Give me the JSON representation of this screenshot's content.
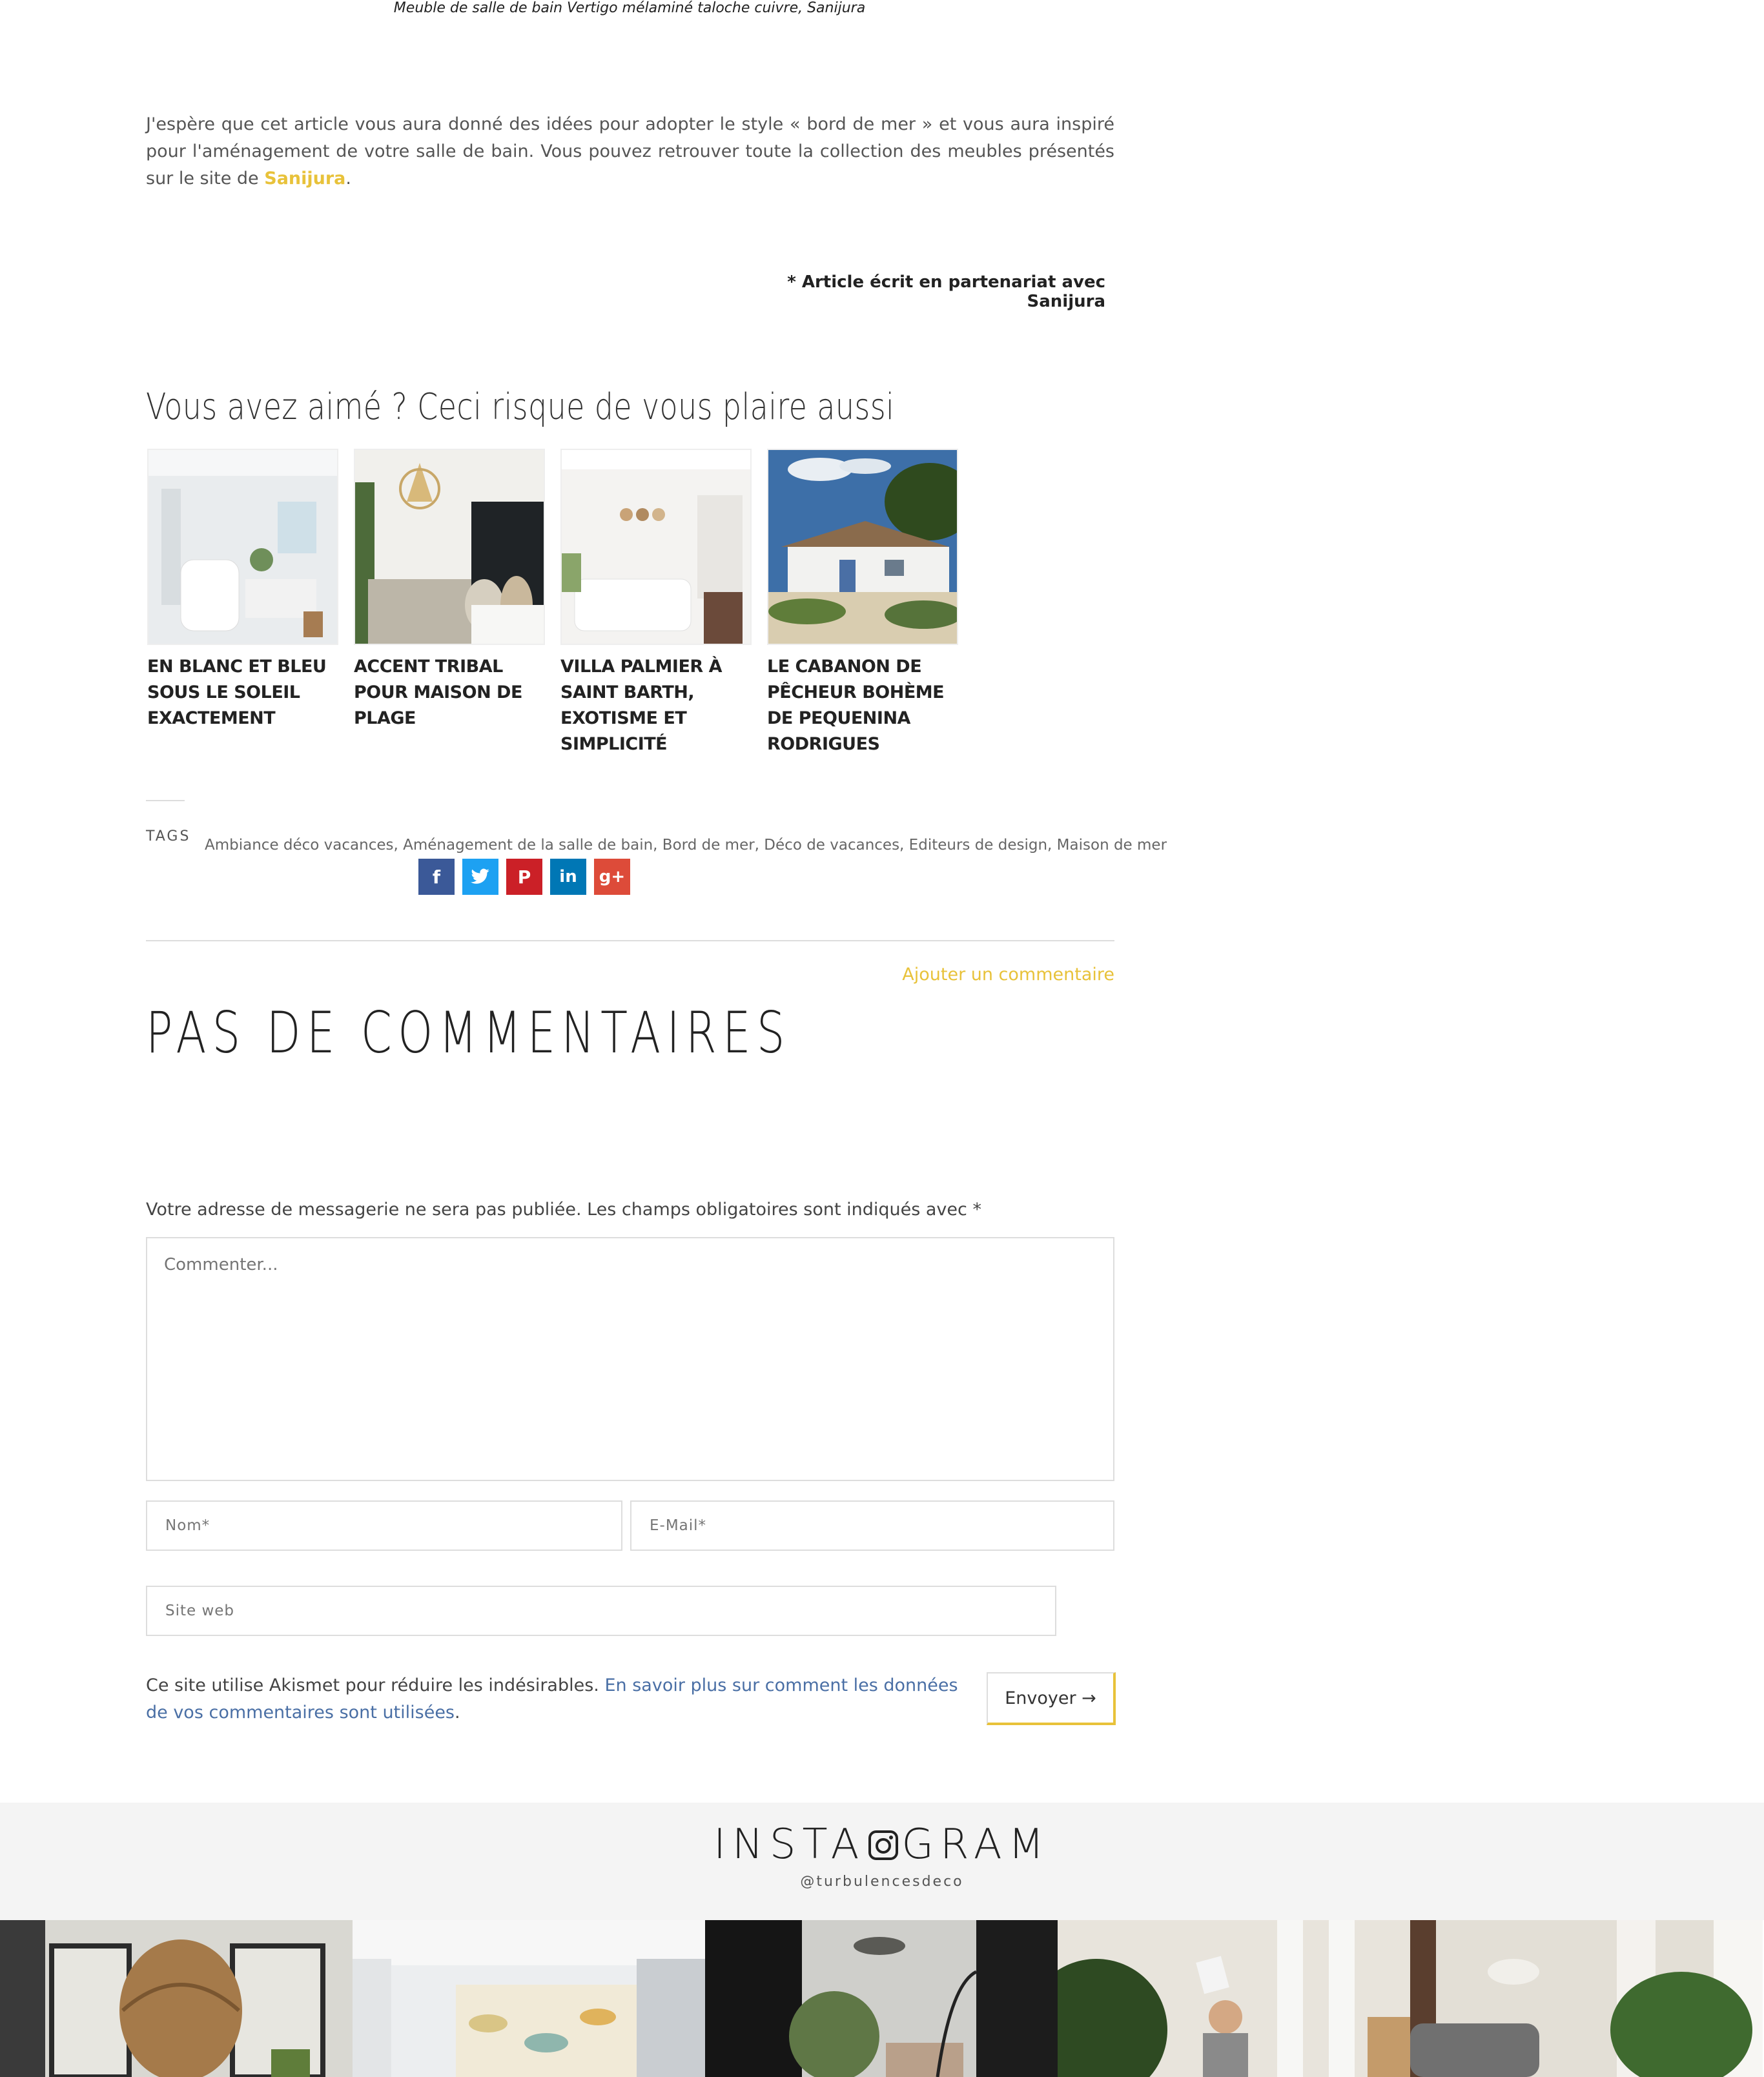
{
  "caption": "Meuble de salle de bain Vertigo mélaminé taloche cuivre, Sanijura",
  "article": {
    "paragraph_text": "J'espère que cet article vous aura donné des idées pour adopter le style « bord de mer » et vous aura inspiré pour l'aménagement de votre salle de bain. Vous pouvez retrouver toute la collection des meubles présentés sur le site de ",
    "paragraph_link": "Sanijura",
    "paragraph_end": ".",
    "partner_note": "* Article écrit en partenariat avec Sanijura"
  },
  "related": {
    "title": "Vous avez aimé ? Ceci risque de vous plaire aussi",
    "items": [
      {
        "title": "EN BLANC ET BLEU SOUS LE SOLEIL EXACTEMENT"
      },
      {
        "title": "ACCENT TRIBAL POUR MAISON DE PLAGE"
      },
      {
        "title": "VILLA PALMIER À SAINT BARTH, EXOTISME ET SIMPLICITÉ"
      },
      {
        "title": "LE CABANON DE PÊCHEUR BOHÈME DE PEQUENINA RODRIGUES"
      }
    ]
  },
  "tags": {
    "label": "TAGS",
    "list": "Ambiance déco vacances, Aménagement de la salle de bain, Bord de mer, Déco de vacances, Editeurs de design, Maison de mer"
  },
  "social": [
    {
      "icon": "facebook-icon",
      "glyph": "f",
      "color": "#3b5998"
    },
    {
      "icon": "twitter-icon",
      "glyph": "t",
      "color": "#1da1f2"
    },
    {
      "icon": "pinterest-icon",
      "glyph": "P",
      "color": "#cb2027"
    },
    {
      "icon": "linkedin-icon",
      "glyph": "in",
      "color": "#0077b5"
    },
    {
      "icon": "google-plus-icon",
      "glyph": "g+",
      "color": "#dd4b39"
    }
  ],
  "comments": {
    "add_link": "Ajouter un commentaire",
    "heading": "PAS DE COMMENTAIRES",
    "notice": "Votre adresse de messagerie ne sera pas publiée. Les champs obligatoires sont indiqués avec *",
    "textarea_placeholder": "Commenter...",
    "name_placeholder": "Nom*",
    "email_placeholder": "E-Mail*",
    "website_placeholder": "Site web",
    "akismet_text": "Ce site utilise Akismet pour réduire les indésirables. ",
    "akismet_link": "En savoir plus sur comment les données de vos commentaires sont utilisées",
    "akismet_end": ".",
    "submit_label": "Envoyer →"
  },
  "instagram": {
    "title_left": "INSTA",
    "title_right": "GRAM",
    "handle": "@turbulencesdeco"
  },
  "colors": {
    "accent": "#e8c23a",
    "link_blue": "#4a6fa5"
  }
}
